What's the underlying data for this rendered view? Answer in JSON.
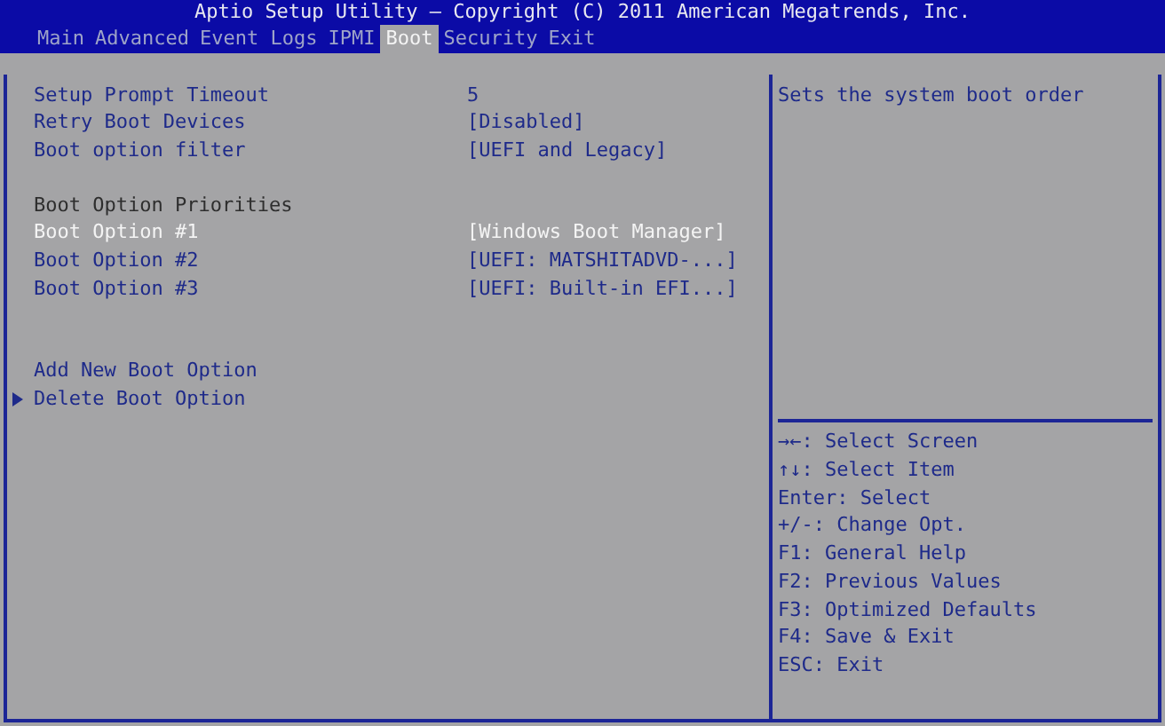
{
  "window": {
    "title": "Aptio Setup Utility – Copyright (C) 2011 American Megatrends, Inc."
  },
  "tabs": [
    {
      "label": "Main",
      "selected": false
    },
    {
      "label": "Advanced",
      "selected": false
    },
    {
      "label": "Event Logs",
      "selected": false
    },
    {
      "label": "IPMI",
      "selected": false
    },
    {
      "label": "Boot",
      "selected": true
    },
    {
      "label": "Security",
      "selected": false
    },
    {
      "label": "Exit",
      "selected": false
    }
  ],
  "groups": [
    {
      "items": [
        {
          "kind": "setting",
          "label": "Setup Prompt Timeout",
          "value": "5",
          "selected": false
        },
        {
          "kind": "setting",
          "label": "Retry Boot Devices",
          "value": "[Disabled]",
          "selected": false
        },
        {
          "kind": "setting",
          "label": "Boot option filter",
          "value": "[UEFI and Legacy]",
          "selected": false
        }
      ]
    },
    {
      "items": [
        {
          "kind": "heading",
          "label": "Boot Option Priorities"
        },
        {
          "kind": "setting",
          "label": "Boot Option #1",
          "value": "[Windows Boot Manager]",
          "selected": true
        },
        {
          "kind": "setting",
          "label": "Boot Option #2",
          "value": "[UEFI: MATSHITADVD-...]",
          "selected": false
        },
        {
          "kind": "setting",
          "label": "Boot Option #3",
          "value": "[UEFI: Built-in EFI...]",
          "selected": false
        }
      ]
    },
    {
      "items": [
        {
          "kind": "action",
          "label": "Add New Boot Option",
          "submenu": false,
          "selected": false
        },
        {
          "kind": "action",
          "label": "Delete Boot Option",
          "submenu": true,
          "selected": false
        }
      ]
    }
  ],
  "help_text": "Sets the system boot order",
  "key_help": [
    "→←: Select Screen",
    "↑↓: Select Item",
    "Enter: Select",
    "+/-: Change Opt.",
    "F1: General Help",
    "F2: Previous Values",
    "F3: Optimized Defaults",
    "F4: Save & Exit",
    "ESC: Exit"
  ]
}
